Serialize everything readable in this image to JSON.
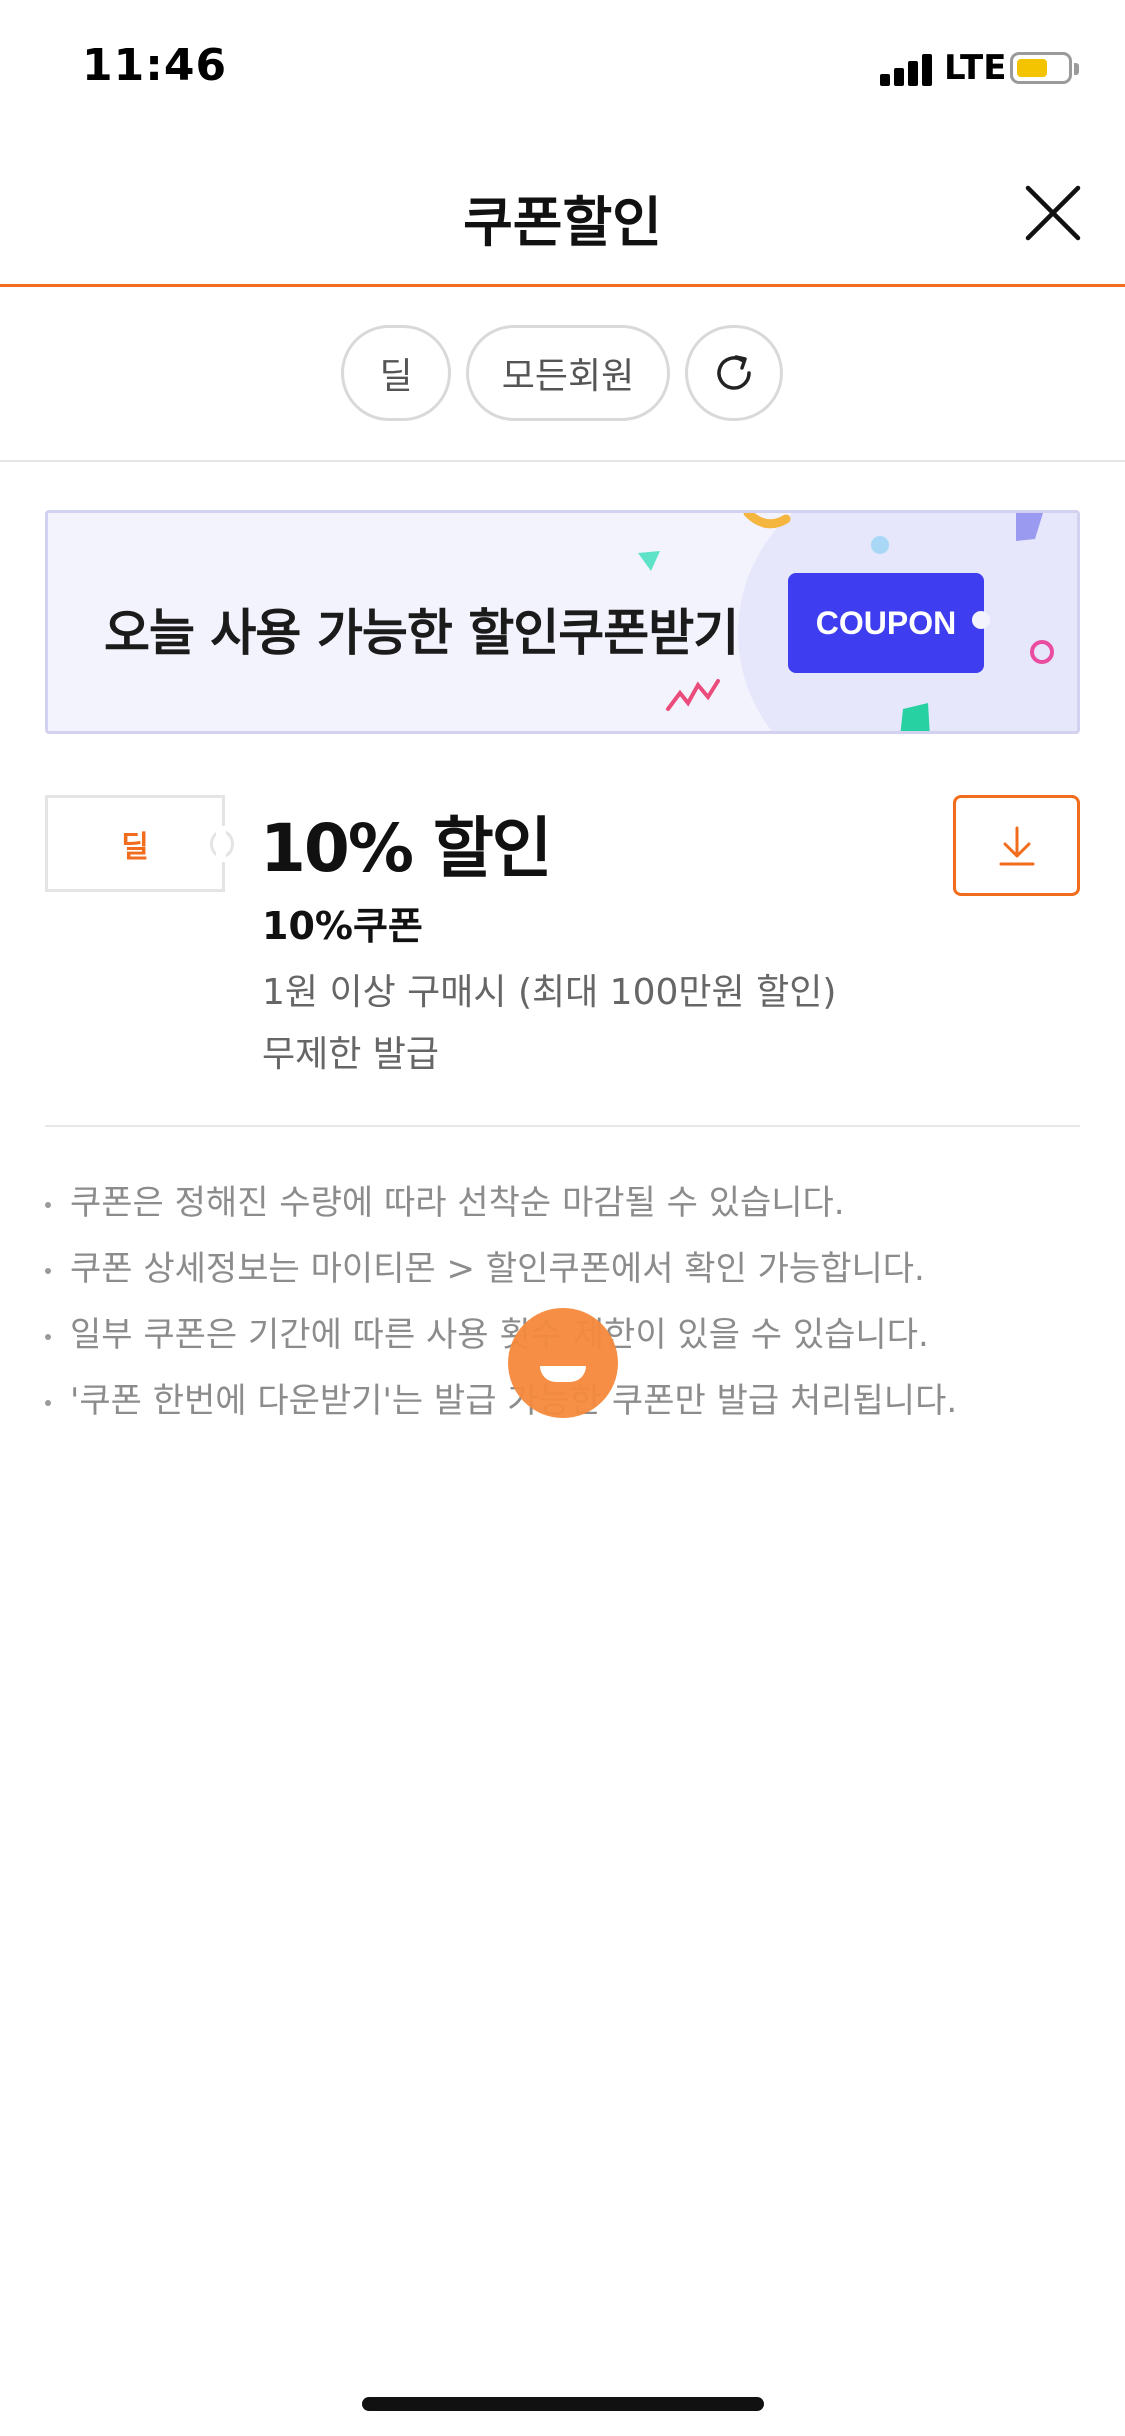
{
  "status_bar": {
    "time": "11:46",
    "network": "LTE"
  },
  "header": {
    "title": "쿠폰할인",
    "close_icon": "close-icon"
  },
  "filters": {
    "chips": [
      {
        "label": "딜"
      },
      {
        "label": "모든회원"
      }
    ],
    "refresh_icon": "refresh-icon"
  },
  "banner": {
    "text": "오늘 사용 가능한 할인쿠폰받기",
    "badge": "COUPON"
  },
  "coupon": {
    "tag": "딜",
    "discount": "10% 할인",
    "name": "10%쿠폰",
    "condition": "1원 이상 구매시 (최대 100만원 할인)",
    "limit": "무제한 발급",
    "download_icon": "download-icon"
  },
  "notices": [
    "쿠폰은 정해진 수량에 따라 선착순 마감될 수 있습니다.",
    "쿠폰 상세정보는 마이티몬 > 할인쿠폰에서 확인 가능합니다.",
    "일부 쿠폰은 기간에 따른 사용 횟수 제한이 있을 수 있습니다.",
    "'쿠폰 한번에 다운받기'는 발급 가능한 쿠폰만 발급 처리됩니다."
  ],
  "colors": {
    "accent": "#f26c1d",
    "coupon_badge": "#3e3ef0",
    "battery": "#f5c400"
  }
}
